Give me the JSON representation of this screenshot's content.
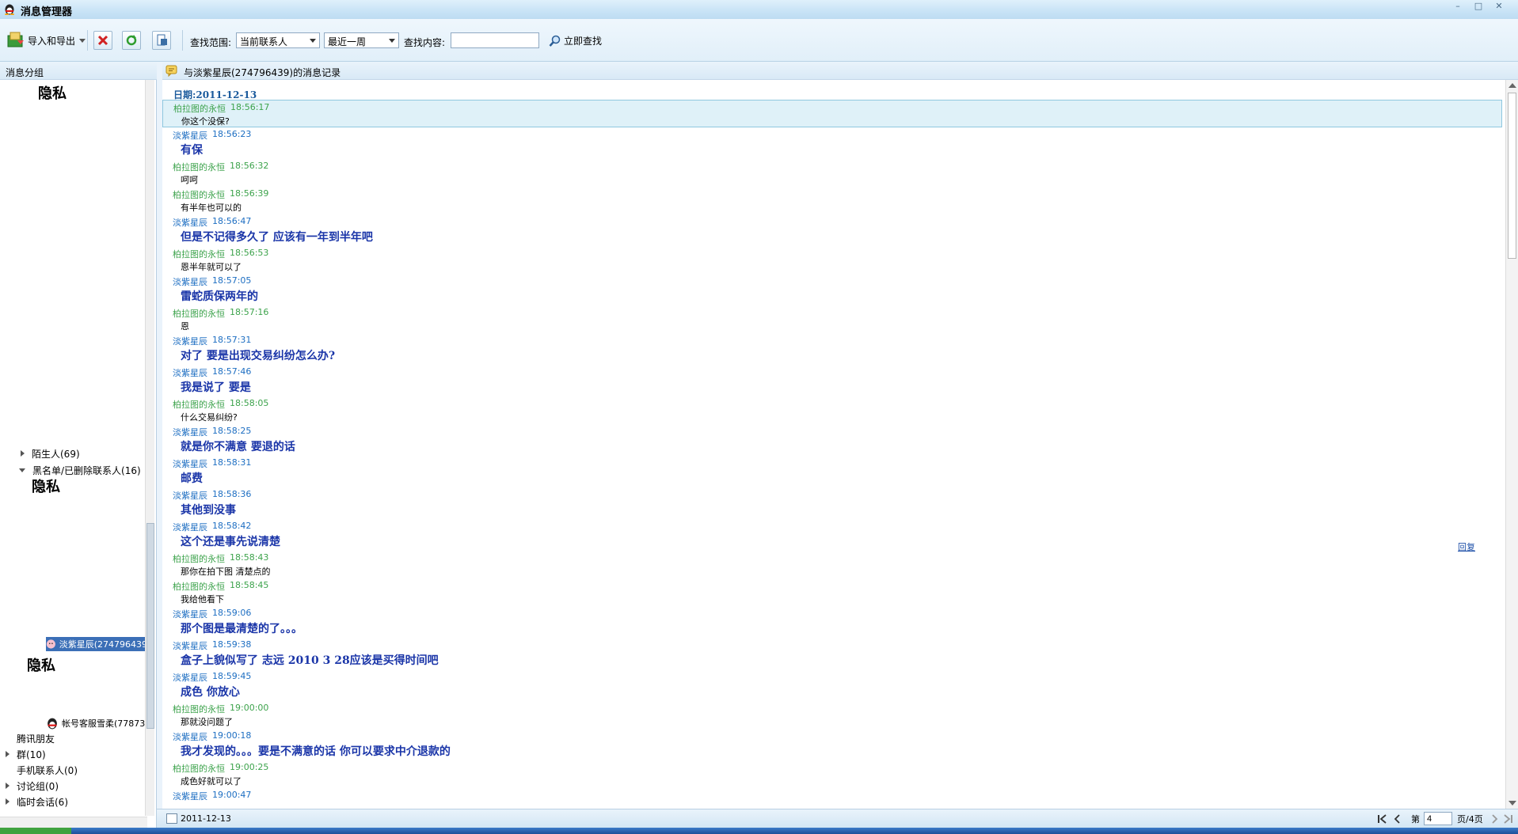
{
  "window": {
    "title": "消息管理器",
    "minimize": "–",
    "maximize": "□",
    "close": "✕"
  },
  "toolbar": {
    "import_export_label": "导入和导出",
    "search_range_label": "查找范围:",
    "contact_select": "当前联系人",
    "period_select": "最近一周",
    "search_content_label": "查找内容:",
    "search_value": "",
    "search_now_label": "立即查找"
  },
  "sidebar": {
    "header": "消息分组",
    "privacy_label_1": "隐私",
    "strangers": "陌生人(69)",
    "blacklist": "黑名单/已删除联系人(16)",
    "privacy_label_2": "隐私",
    "selected_contact": "淡紫星辰(274796439",
    "privacy_label_3": "隐私",
    "service_contact": "帐号客服雪柔(77873",
    "tencent_friends": "腾讯朋友",
    "groups": "群(10)",
    "mobile_contacts": "手机联系人(0)",
    "discussion_groups": "讨论组(0)",
    "temp_sessions": "临时会话(6)"
  },
  "main": {
    "header": "与淡紫星辰(274796439)的消息记录",
    "date_line": "日期:2011-12-13",
    "reply_label": "回复",
    "messages": [
      {
        "sender": "柏拉图的永恒",
        "time": "18:56:17",
        "text": "你这个没保?"
      },
      {
        "sender": "淡紫星辰",
        "time": "18:56:23",
        "text": "有保"
      },
      {
        "sender": "柏拉图的永恒",
        "time": "18:56:32",
        "text": "呵呵"
      },
      {
        "sender": "柏拉图的永恒",
        "time": "18:56:39",
        "text": "有半年也可以的"
      },
      {
        "sender": "淡紫星辰",
        "time": "18:56:47",
        "text": "但是不记得多久了 应该有一年到半年吧"
      },
      {
        "sender": "柏拉图的永恒",
        "time": "18:56:53",
        "text": "恩半年就可以了"
      },
      {
        "sender": "淡紫星辰",
        "time": "18:57:05",
        "text": "雷蛇质保两年的"
      },
      {
        "sender": "柏拉图的永恒",
        "time": "18:57:16",
        "text": "恩"
      },
      {
        "sender": "淡紫星辰",
        "time": "18:57:31",
        "text": "对了 要是出现交易纠纷怎么办?"
      },
      {
        "sender": "淡紫星辰",
        "time": "18:57:46",
        "text": "我是说了 要是"
      },
      {
        "sender": "柏拉图的永恒",
        "time": "18:58:05",
        "text": "什么交易纠纷?"
      },
      {
        "sender": "淡紫星辰",
        "time": "18:58:25",
        "text": "就是你不满意  要退的话"
      },
      {
        "sender": "淡紫星辰",
        "time": "18:58:31",
        "text": "邮费"
      },
      {
        "sender": "淡紫星辰",
        "time": "18:58:36",
        "text": "其他到没事"
      },
      {
        "sender": "淡紫星辰",
        "time": "18:58:42",
        "text": "这个还是事先说清楚"
      },
      {
        "sender": "柏拉图的永恒",
        "time": "18:58:43",
        "text": "那你在拍下图 清楚点的"
      },
      {
        "sender": "柏拉图的永恒",
        "time": "18:58:45",
        "text": "我给他看下"
      },
      {
        "sender": "淡紫星辰",
        "time": "18:59:06",
        "text": "那个图是最清楚的了。。。"
      },
      {
        "sender": "淡紫星辰",
        "time": "18:59:38",
        "text": "盒子上貌似写了 志远 2010 3 28应该是买得时间吧"
      },
      {
        "sender": "淡紫星辰",
        "time": "18:59:45",
        "text": "成色 你放心"
      },
      {
        "sender": "柏拉图的永恒",
        "time": "19:00:00",
        "text": "那就没问题了"
      },
      {
        "sender": "淡紫星辰",
        "time": "19:00:18",
        "text": "我才发现的。。。要是不满意的话 你可以要求中介退款的"
      },
      {
        "sender": "柏拉图的永恒",
        "time": "19:00:25",
        "text": "成色好就可以了"
      },
      {
        "sender": "淡紫星辰",
        "time": "19:00:47",
        "text": ""
      }
    ]
  },
  "bottom": {
    "date": "2011-12-13",
    "page_prefix": "第",
    "page_value": "4",
    "page_suffix": "页/4页"
  },
  "colors": {
    "me_sender": "#3da34c",
    "them_sender": "#1d6ec2",
    "bold_text": "#1a35a8",
    "selection_bg": "#dff1f8"
  }
}
